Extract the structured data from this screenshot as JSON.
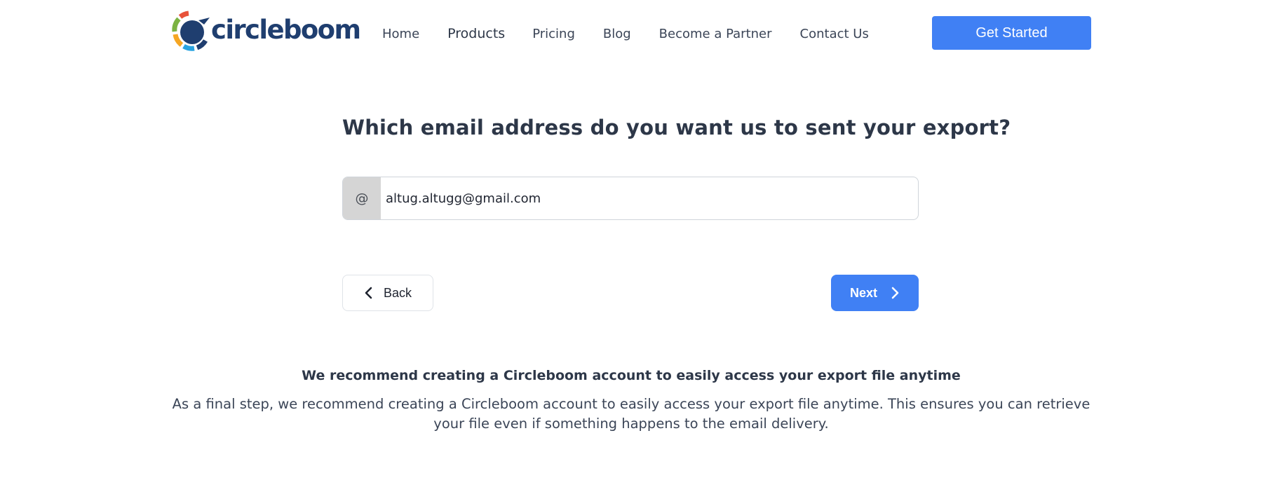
{
  "brand": {
    "name": "circleboom",
    "text_color": "#1f3e6f",
    "ring_colors": [
      "#e8523a",
      "#f5a623",
      "#7cb342",
      "#29a3e0",
      "#1f3e6f"
    ]
  },
  "nav": {
    "items": [
      {
        "label": "Home"
      },
      {
        "label": "Products"
      },
      {
        "label": "Pricing"
      },
      {
        "label": "Blog"
      },
      {
        "label": "Become a Partner"
      },
      {
        "label": "Contact Us"
      }
    ],
    "cta_label": "Get Started"
  },
  "form": {
    "title": "Which email address do you want us to sent your export?",
    "email_prefix": "@",
    "email_value": "altug.altugg@gmail.com",
    "back_label": "Back",
    "next_label": "Next",
    "icons": {
      "back": "chevron-left-icon",
      "next": "chevron-right-icon"
    }
  },
  "recommendation": {
    "title": "We recommend creating a Circleboom account to easily access your export file anytime",
    "body": "As a final step, we recommend creating a Circleboom account to easily access your export file anytime. This ensures you can retrieve your file even if something happens to the email delivery."
  },
  "colors": {
    "accent": "#4080f4",
    "text": "#2d3748",
    "prefix_bg": "#d5d5d5"
  }
}
